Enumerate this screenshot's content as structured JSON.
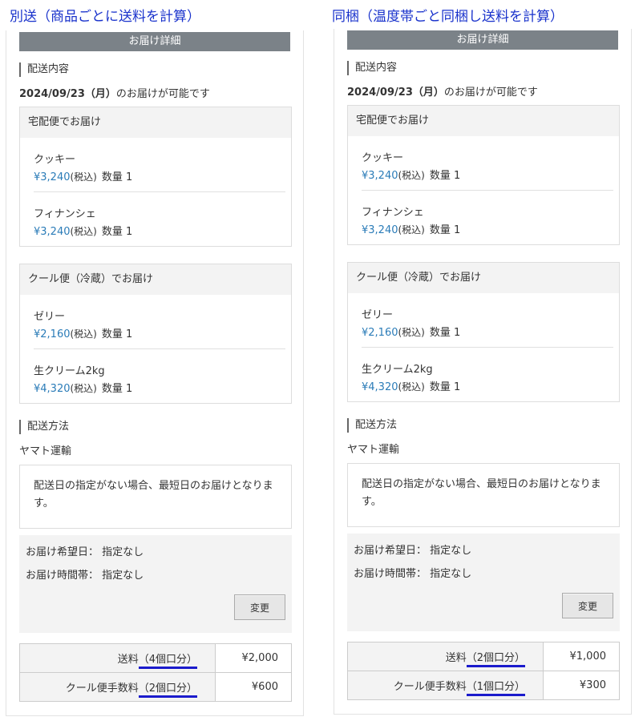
{
  "columns": [
    {
      "title": "別送（商品ごとに送料を計算）",
      "header": "お届け詳細",
      "delivery_section": "配送内容",
      "date": "2024/09/23（月）",
      "date_suffix": "のお届けが可能です",
      "groups": [
        {
          "title": "宅配便でお届け",
          "items": [
            {
              "name": "クッキー",
              "price": "¥3,240",
              "tax": "(税込)",
              "qty": "数量 1"
            },
            {
              "name": "フィナンシェ",
              "price": "¥3,240",
              "tax": "(税込)",
              "qty": "数量 1"
            }
          ]
        },
        {
          "title": "クール便（冷蔵）でお届け",
          "items": [
            {
              "name": "ゼリー",
              "price": "¥2,160",
              "tax": "(税込)",
              "qty": "数量 1"
            },
            {
              "name": "生クリーム2kg",
              "price": "¥4,320",
              "tax": "(税込)",
              "qty": "数量 1"
            }
          ]
        }
      ],
      "method_section": "配送方法",
      "carrier": "ヤマト運輸",
      "notice": "配送日の指定がない場合、最短日のお届けとなります。",
      "pref_date": "お届け希望日：  指定なし",
      "pref_time": "お届け時間帯：  指定なし",
      "change_label": "変更",
      "fees": [
        {
          "label": "送料",
          "detail": "（4個口分）",
          "value": "¥2,000"
        },
        {
          "label": "クール便手数料",
          "detail": "（2個口分）",
          "value": "¥600"
        }
      ]
    },
    {
      "title": "同梱（温度帯ごと同梱し送料を計算）",
      "header": "お届け詳細",
      "delivery_section": "配送内容",
      "date": "2024/09/23（月）",
      "date_suffix": "のお届けが可能です",
      "groups": [
        {
          "title": "宅配便でお届け",
          "items": [
            {
              "name": "クッキー",
              "price": "¥3,240",
              "tax": "(税込)",
              "qty": "数量 1"
            },
            {
              "name": "フィナンシェ",
              "price": "¥3,240",
              "tax": "(税込)",
              "qty": "数量 1"
            }
          ]
        },
        {
          "title": "クール便（冷蔵）でお届け",
          "items": [
            {
              "name": "ゼリー",
              "price": "¥2,160",
              "tax": "(税込)",
              "qty": "数量 1"
            },
            {
              "name": "生クリーム2kg",
              "price": "¥4,320",
              "tax": "(税込)",
              "qty": "数量 1"
            }
          ]
        }
      ],
      "method_section": "配送方法",
      "carrier": "ヤマト運輸",
      "notice": "配送日の指定がない場合、最短日のお届けとなります。",
      "pref_date": "お届け希望日：  指定なし",
      "pref_time": "お届け時間帯：  指定なし",
      "change_label": "変更",
      "fees": [
        {
          "label": "送料",
          "detail": "（2個口分）",
          "value": "¥1,000"
        },
        {
          "label": "クール便手数料",
          "detail": "（1個口分）",
          "value": "¥300"
        }
      ]
    }
  ]
}
